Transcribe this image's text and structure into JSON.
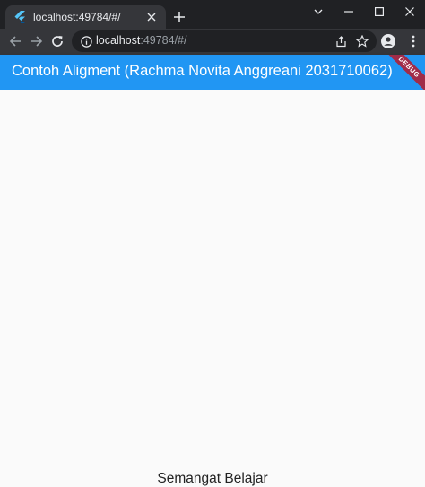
{
  "browser": {
    "tab_title": "localhost:49784/#/",
    "url_host": "localhost",
    "url_rest": ":49784/#/",
    "icons": [
      "flutter-favicon",
      "close-icon",
      "plus-icon",
      "back-arrow-icon",
      "forward-arrow-icon",
      "reload-icon",
      "info-icon",
      "share-icon",
      "star-icon",
      "profile-icon",
      "menu-dots-icon",
      "minimize-icon",
      "maximize-icon",
      "chevron-down-icon"
    ]
  },
  "app": {
    "title": "Contoh Aligment (Rachma Novita Anggreani 2031710062)",
    "debug_label": "DEBUG",
    "bottom_text": "Semangat Belajar",
    "colors": {
      "appbar": "#2196f3",
      "debug_banner": "#a12c49",
      "background": "#fafafa"
    }
  }
}
